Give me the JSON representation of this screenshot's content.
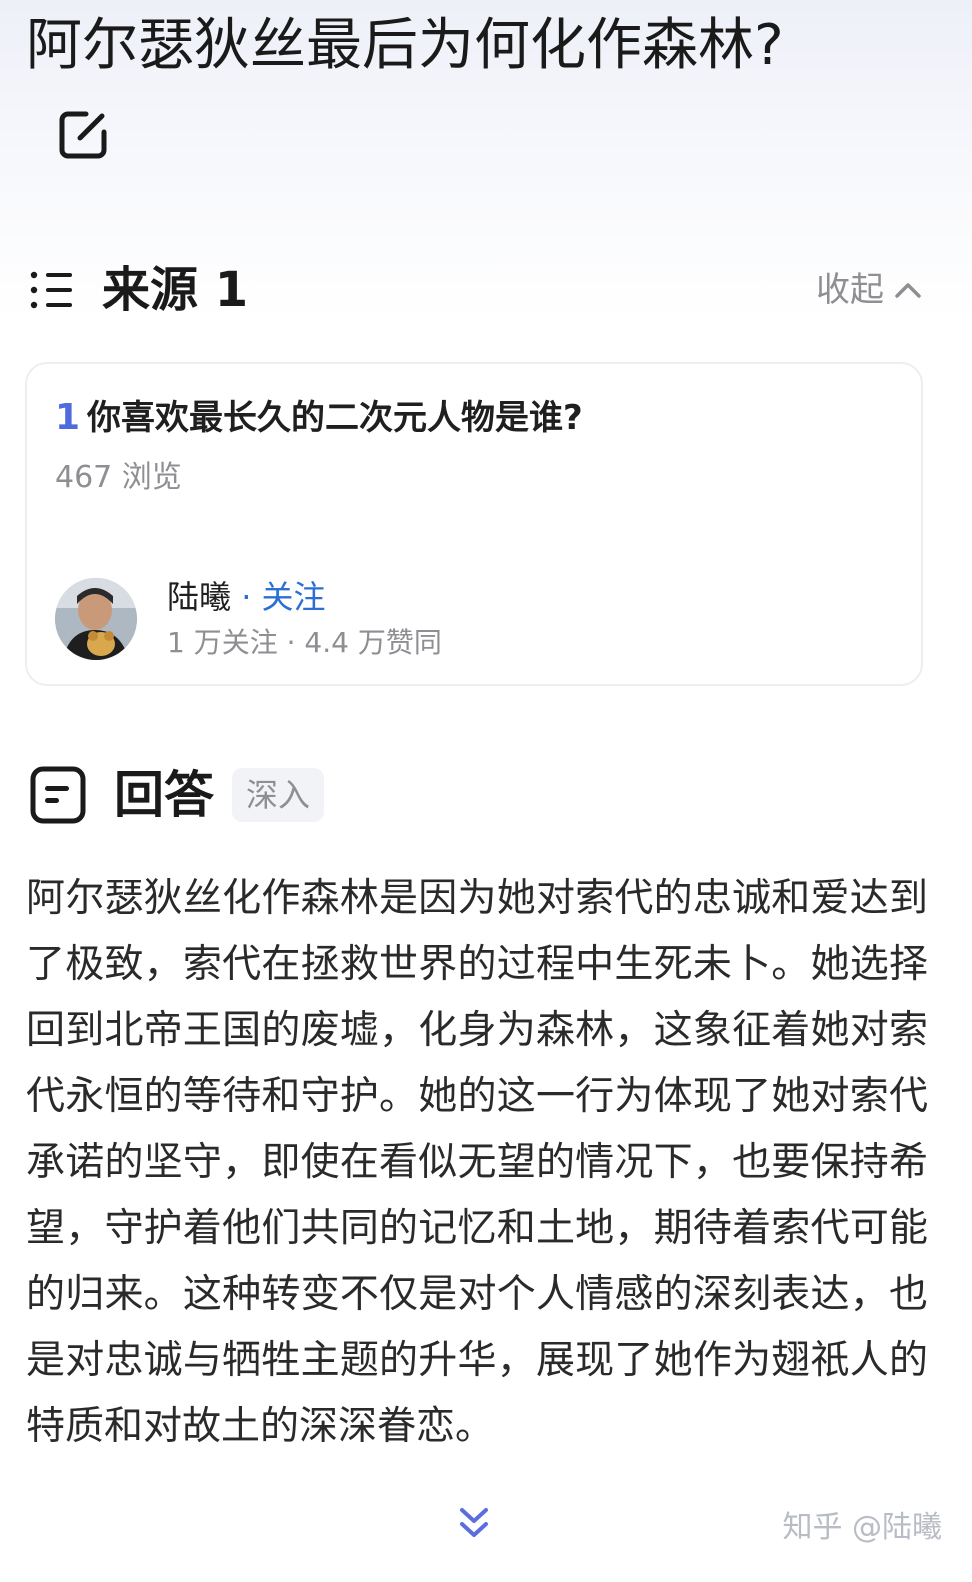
{
  "question": {
    "title": "阿尔瑟狄丝最后为何化作森林?"
  },
  "sources": {
    "title": "来源 1",
    "collapse_label": "收起",
    "items": [
      {
        "index": "1",
        "question": "你喜欢最长久的二次元人物是谁?",
        "views": "467 浏览",
        "author": {
          "name": "陆曦",
          "follow_prefix": " · ",
          "follow_label": "关注",
          "stats": "1 万关注 · 4.4 万赞同"
        }
      }
    ]
  },
  "answer": {
    "title": "回答",
    "badge": "深入",
    "body": "阿尔瑟狄丝化作森林是因为她对索代的忠诚和爱达到了极致，索代在拯救世界的过程中生死未卜。她选择回到北帝王国的废墟，化身为森林，这象征着她对索代永恒的等待和守护。她的这一行为体现了她对索代承诺的坚守，即使在看似无望的情况下，也要保持希望，守护着他们共同的记忆和土地，期待着索代可能的归来。这种转变不仅是对个人情感的深刻表达，也是对忠诚与牺牲主题的升华，展现了她作为翅祇人的特质和对故土的深深眷恋。"
  },
  "watermark": "知乎 @陆曦",
  "icons": {
    "edit": "edit-icon",
    "list": "list-icon",
    "collapse": "chevron-up-icon",
    "answer": "document-icon",
    "expand": "double-chevron-down-icon"
  },
  "colors": {
    "accent": "#4f6bdc",
    "link": "#2b6fd6",
    "muted": "#8e8e93"
  }
}
